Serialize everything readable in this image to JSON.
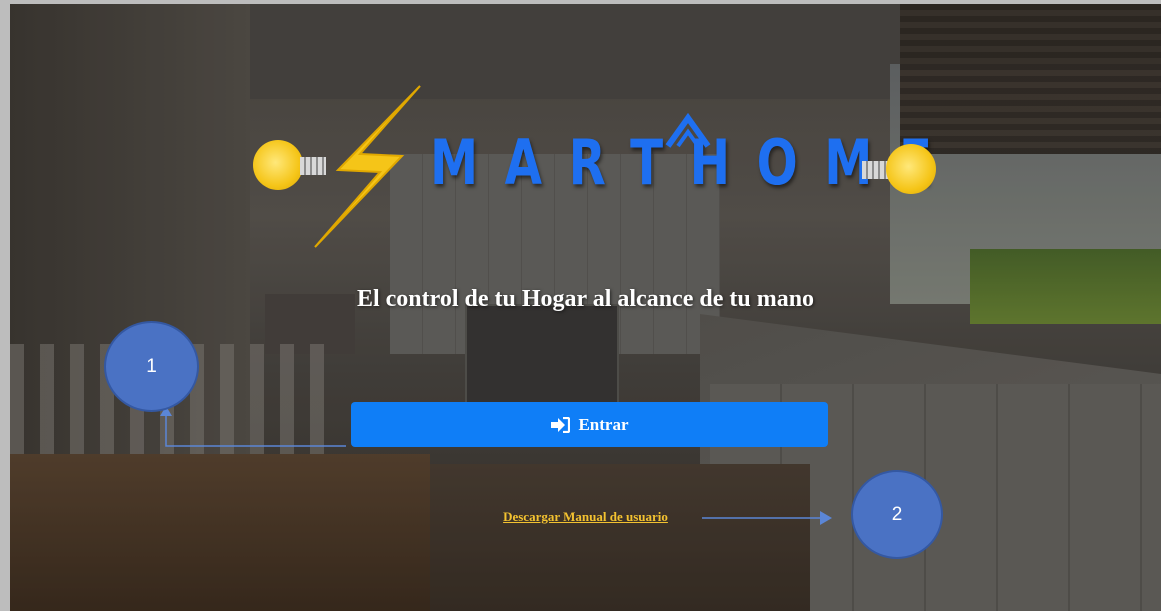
{
  "logo": {
    "wordmark": "MARTHOME",
    "brand_color": "#1e6ff0",
    "bolt_color": "#f5c518"
  },
  "tagline": "El control de tu Hogar al alcance de tu mano",
  "enter_button": {
    "label": "Entrar",
    "icon": "sign-in-icon",
    "color": "#0f7ef7"
  },
  "manual_link": {
    "label": "Descargar Manual de usuario",
    "color": "#f3c230"
  },
  "annotations": [
    {
      "label": "1",
      "color": "#4a72c4"
    },
    {
      "label": "2",
      "color": "#4a72c4"
    }
  ]
}
